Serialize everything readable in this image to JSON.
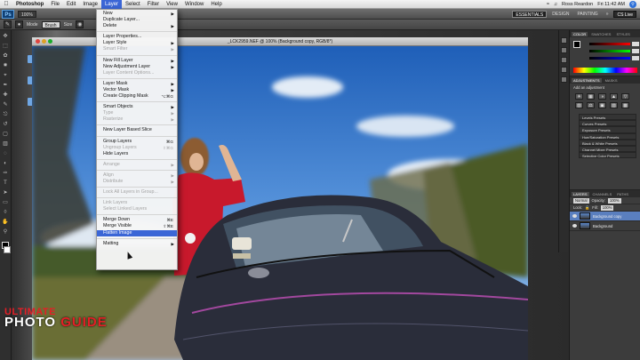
{
  "menubar": {
    "app_name": "Photoshop",
    "items": [
      "File",
      "Edit",
      "Image",
      "Layer",
      "Select",
      "Filter",
      "View",
      "Window",
      "Help"
    ],
    "active_index": 3,
    "user": "Ross Reardon",
    "clock": "Fri 11:42 AM"
  },
  "appbar": {
    "logo": "Ps",
    "zoom": "100%",
    "workspaces": [
      "ESSENTIALS",
      "DESIGN",
      "PAINTING"
    ],
    "active_workspace": 0,
    "cs_live": "CS Live"
  },
  "options_bar": {
    "mode_label": "Mode",
    "mode_value": "Brush",
    "size_label": "Size"
  },
  "document": {
    "title": "_LCK2959.NEF @ 100% (Background copy, RGB/8*)"
  },
  "layer_menu": {
    "groups": [
      [
        {
          "label": "New",
          "sub": true
        },
        {
          "label": "Duplicate Layer..."
        },
        {
          "label": "Delete",
          "sub": true
        }
      ],
      [
        {
          "label": "Layer Properties..."
        },
        {
          "label": "Layer Style",
          "sub": true
        },
        {
          "label": "Smart Filter",
          "disabled": true,
          "sub": true
        }
      ],
      [
        {
          "label": "New Fill Layer",
          "sub": true
        },
        {
          "label": "New Adjustment Layer",
          "sub": true
        },
        {
          "label": "Layer Content Options...",
          "disabled": true
        }
      ],
      [
        {
          "label": "Layer Mask",
          "sub": true
        },
        {
          "label": "Vector Mask",
          "sub": true
        },
        {
          "label": "Create Clipping Mask",
          "shortcut": "⌥⌘G"
        }
      ],
      [
        {
          "label": "Smart Objects",
          "sub": true
        },
        {
          "label": "Type",
          "disabled": true,
          "sub": true
        },
        {
          "label": "Rasterize",
          "disabled": true,
          "sub": true
        }
      ],
      [
        {
          "label": "New Layer Based Slice"
        }
      ],
      [
        {
          "label": "Group Layers",
          "shortcut": "⌘G"
        },
        {
          "label": "Ungroup Layers",
          "disabled": true,
          "shortcut": "⇧⌘G"
        },
        {
          "label": "Hide Layers"
        }
      ],
      [
        {
          "label": "Arrange",
          "disabled": true,
          "sub": true
        }
      ],
      [
        {
          "label": "Align",
          "disabled": true,
          "sub": true
        },
        {
          "label": "Distribute",
          "disabled": true,
          "sub": true
        }
      ],
      [
        {
          "label": "Lock All Layers in Group...",
          "disabled": true
        }
      ],
      [
        {
          "label": "Link Layers",
          "disabled": true
        },
        {
          "label": "Select Linked Layers",
          "disabled": true
        }
      ],
      [
        {
          "label": "Merge Down",
          "shortcut": "⌘E"
        },
        {
          "label": "Merge Visible",
          "shortcut": "⇧⌘E"
        },
        {
          "label": "Flatten Image",
          "highlighted": true
        }
      ],
      [
        {
          "label": "Matting",
          "sub": true
        }
      ]
    ]
  },
  "panels": {
    "color_tabs": [
      "COLOR",
      "SWATCHES",
      "STYLES"
    ],
    "adj_tabs": [
      "ADJUSTMENTS",
      "MASKS"
    ],
    "adj_title": "Add an adjustment",
    "adj_icons": [
      "☀",
      "▦",
      "◑",
      "▲",
      "▽",
      "▧",
      "⚖",
      "▣",
      "▨",
      "▩"
    ],
    "presets": [
      "Levels Presets",
      "Curves Presets",
      "Exposure Presets",
      "Hue/Saturation Presets",
      "Black & White Presets",
      "Channel Mixer Presets",
      "Selective Color Presets"
    ],
    "layer_tabs": [
      "LAYERS",
      "CHANNELS",
      "PATHS"
    ],
    "blend_mode": "Normal",
    "opacity_label": "Opacity:",
    "opacity": "100%",
    "lock_label": "Lock:",
    "fill_label": "Fill:",
    "fill": "100%",
    "layers": [
      {
        "name": "Background copy",
        "selected": true
      },
      {
        "name": "Background",
        "selected": false
      }
    ]
  },
  "watermark": {
    "line1": "ULTIMATE",
    "line2a": "PHOTO ",
    "line2b": "GUIDE"
  },
  "colors": {
    "menu_highlight": "#3b66d6",
    "sky": "#3f7ecf",
    "coat": "#c8192c",
    "car": "#2a2d3a",
    "logo_red": "#e41e26"
  }
}
